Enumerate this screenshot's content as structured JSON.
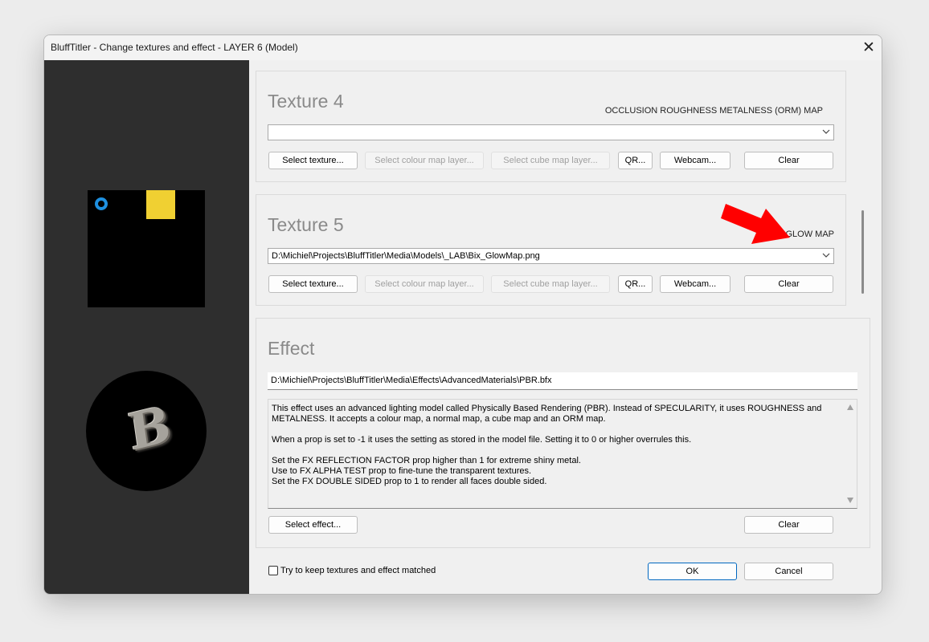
{
  "window": {
    "title": "BluffTitler - Change textures and effect - LAYER 6 (Model)",
    "close_icon": "close-icon"
  },
  "preview": {
    "letter": "B"
  },
  "texture4": {
    "title": "Texture 4",
    "map_label": "OCCLUSION ROUGHNESS METALNESS (ORM) MAP",
    "path": "",
    "buttons": {
      "select_texture": "Select texture...",
      "select_colour_map_layer": "Select colour map layer...",
      "select_cube_map_layer": "Select cube map layer...",
      "qr": "QR...",
      "webcam": "Webcam...",
      "clear": "Clear"
    }
  },
  "texture5": {
    "title": "Texture 5",
    "map_label": "GLOW MAP",
    "path": "D:\\Michiel\\Projects\\BluffTitler\\Media\\Models\\_LAB\\Bix_GlowMap.png",
    "buttons": {
      "select_texture": "Select texture...",
      "select_colour_map_layer": "Select colour map layer...",
      "select_cube_map_layer": "Select cube map layer...",
      "qr": "QR...",
      "webcam": "Webcam...",
      "clear": "Clear"
    }
  },
  "effect": {
    "title": "Effect",
    "path": "D:\\Michiel\\Projects\\BluffTitler\\Media\\Effects\\AdvancedMaterials\\PBR.bfx",
    "description": {
      "line1": "This effect uses an advanced lighting model called Physically Based Rendering (PBR). Instead of SPECULARITY, it uses ROUGHNESS and",
      "line2": "METALNESS. It accepts a colour map, a normal map, a cube map and an ORM map.",
      "line3": "When a prop is set to -1 it uses the setting as stored in the model file. Setting it to 0 or higher overrules this.",
      "line4": "Set the FX REFLECTION FACTOR prop higher than 1 for extreme shiny metal.",
      "line5": "Use to FX ALPHA TEST prop to fine-tune the transparent textures.",
      "line6": "Set the FX DOUBLE SIDED prop to 1 to render all faces double sided."
    },
    "buttons": {
      "select_effect": "Select effect...",
      "clear": "Clear"
    }
  },
  "footer": {
    "checkbox_label": "Try to keep textures and effect matched",
    "checkbox_checked": false,
    "ok": "OK",
    "cancel": "Cancel"
  },
  "colors": {
    "left_panel": "#2e2e2e",
    "accent_blue": "#0067c0",
    "arrow_red": "#ff0000",
    "preview_yellow": "#f0d032",
    "preview_blue": "#1e90e0"
  }
}
